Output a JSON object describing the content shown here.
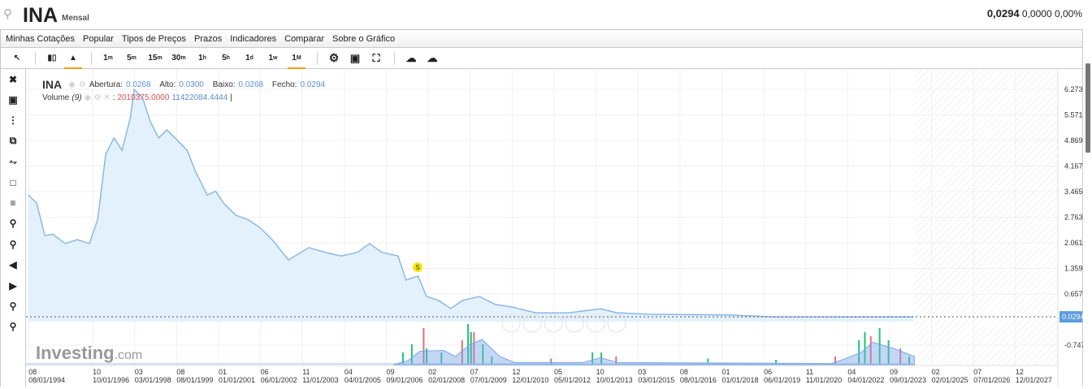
{
  "header": {
    "symbol": "INA",
    "period": "Mensal",
    "price": "0,0294",
    "change": "0,0000",
    "change_pct": "0,00%"
  },
  "menu": [
    "Minhas Cotações",
    "Popular",
    "Tipos de Preços",
    "Prazos",
    "Indicadores",
    "Comparar",
    "Sobre o Gráfico"
  ],
  "toolbar": {
    "intervals": [
      {
        "n": "1",
        "u": "m"
      },
      {
        "n": "5",
        "u": "m"
      },
      {
        "n": "15",
        "u": "m"
      },
      {
        "n": "30",
        "u": "m"
      },
      {
        "n": "1",
        "u": "h"
      },
      {
        "n": "5",
        "u": "h"
      },
      {
        "n": "1",
        "u": "d"
      },
      {
        "n": "1",
        "u": "w"
      },
      {
        "n": "1",
        "u": "M"
      }
    ],
    "active_interval": "1M"
  },
  "legend": {
    "symbol": "INA",
    "open_label": "Abertura:",
    "open": "0.0268",
    "high_label": "Alto:",
    "high": "0.0300",
    "low_label": "Baixo:",
    "low": "0.0268",
    "close_label": "Fecho:",
    "close": "0.0294",
    "volume_label": "Volume",
    "volume_period": "(9)",
    "volume_value": "2010375.0000",
    "volume_ma": "11422084.4444",
    "cursor": "|"
  },
  "watermark": "Investing",
  "watermark_suffix": ".com",
  "marker": "S",
  "colors": {
    "line": "#8ab8e6",
    "fill": "#e3f1fc",
    "up": "#1ec47a",
    "down": "#e0707a",
    "vol_ma": "#7aa6e8",
    "accent": "#f39c12"
  },
  "chart_data": {
    "type": "area",
    "y_ticks": [
      "6.2730",
      "5.5710",
      "4.8690",
      "4.1670",
      "3.4650",
      "2.7630",
      "2.0610",
      "1.3590",
      "0.6570",
      "-0.7470"
    ],
    "ylim": [
      -0.747,
      6.273
    ],
    "last_price": "0.0294",
    "x_ticks": [
      [
        "08",
        "08/01/1994"
      ],
      [
        "10",
        "10/01/1996"
      ],
      [
        "03",
        "03/01/1998"
      ],
      [
        "08",
        "08/01/1999"
      ],
      [
        "01",
        "01/01/2001"
      ],
      [
        "06",
        "06/01/2002"
      ],
      [
        "11",
        "11/01/2003"
      ],
      [
        "04",
        "04/01/2005"
      ],
      [
        "09",
        "09/01/2006"
      ],
      [
        "02",
        "02/01/2008"
      ],
      [
        "07",
        "07/01/2009"
      ],
      [
        "12",
        "12/01/2010"
      ],
      [
        "05",
        "05/01/2012"
      ],
      [
        "10",
        "10/01/2013"
      ],
      [
        "03",
        "03/01/2015"
      ],
      [
        "08",
        "08/01/2016"
      ],
      [
        "01",
        "01/01/2018"
      ],
      [
        "06",
        "06/01/2019"
      ],
      [
        "11",
        "11/01/2020"
      ],
      [
        "04",
        "04/01/2022"
      ],
      [
        "09",
        "09/01/2023"
      ],
      [
        "02",
        "02/01/2025"
      ],
      [
        "07",
        "07/01/2026"
      ],
      [
        "12",
        "12/01/2027"
      ]
    ],
    "xlim": [
      1994.58,
      2027.92
    ],
    "price": [
      [
        1994.58,
        3.37
      ],
      [
        1994.86,
        3.15
      ],
      [
        1995.13,
        2.26
      ],
      [
        1995.4,
        2.3
      ],
      [
        1995.82,
        2.04
      ],
      [
        1996.23,
        2.15
      ],
      [
        1996.64,
        2.04
      ],
      [
        1996.92,
        2.71
      ],
      [
        1997.19,
        4.49
      ],
      [
        1997.47,
        4.94
      ],
      [
        1997.74,
        4.6
      ],
      [
        1998.02,
        5.49
      ],
      [
        1998.15,
        6.27
      ],
      [
        1998.43,
        6.05
      ],
      [
        1998.7,
        5.38
      ],
      [
        1998.98,
        4.94
      ],
      [
        1999.25,
        5.16
      ],
      [
        1999.53,
        4.94
      ],
      [
        1999.94,
        4.6
      ],
      [
        2000.21,
        4.04
      ],
      [
        2000.62,
        3.37
      ],
      [
        2000.9,
        3.48
      ],
      [
        2001.17,
        3.15
      ],
      [
        2001.58,
        2.82
      ],
      [
        2001.99,
        2.7
      ],
      [
        2002.4,
        2.48
      ],
      [
        2002.81,
        2.15
      ],
      [
        2003.36,
        1.59
      ],
      [
        2004.05,
        1.93
      ],
      [
        2004.6,
        1.8
      ],
      [
        2005.15,
        1.7
      ],
      [
        2005.69,
        1.8
      ],
      [
        2006.1,
        2.04
      ],
      [
        2006.51,
        1.8
      ],
      [
        2007.06,
        1.7
      ],
      [
        2007.33,
        1.04
      ],
      [
        2007.74,
        1.15
      ],
      [
        2008.02,
        0.59
      ],
      [
        2008.43,
        0.48
      ],
      [
        2008.84,
        0.26
      ],
      [
        2009.25,
        0.48
      ],
      [
        2009.8,
        0.59
      ],
      [
        2010.35,
        0.37
      ],
      [
        2010.9,
        0.3
      ],
      [
        2011.72,
        0.14
      ],
      [
        2012.81,
        0.14
      ],
      [
        2013.91,
        0.25
      ],
      [
        2014.46,
        0.14
      ],
      [
        2015.56,
        0.1
      ],
      [
        2018.3,
        0.08
      ],
      [
        2019.67,
        0.03
      ],
      [
        2021.04,
        0.03
      ],
      [
        2024.47,
        0.03
      ]
    ],
    "volume": [
      [
        2007.2,
        0.3
      ],
      [
        2007.5,
        0.5
      ],
      [
        2007.9,
        0.9
      ],
      [
        2008.0,
        0.4
      ],
      [
        2008.5,
        0.3
      ],
      [
        2009.2,
        0.6
      ],
      [
        2009.4,
        1.0
      ],
      [
        2009.5,
        0.8
      ],
      [
        2009.6,
        0.8
      ],
      [
        2009.9,
        0.5
      ],
      [
        2010.2,
        0.2
      ],
      [
        2012.2,
        0.15
      ],
      [
        2013.6,
        0.3
      ],
      [
        2013.9,
        0.3
      ],
      [
        2014.4,
        0.2
      ],
      [
        2017.5,
        0.15
      ],
      [
        2019.8,
        0.12
      ],
      [
        2021.8,
        0.2
      ],
      [
        2022.6,
        0.6
      ],
      [
        2022.8,
        0.8
      ],
      [
        2023.0,
        0.7
      ],
      [
        2023.3,
        0.9
      ],
      [
        2023.6,
        0.6
      ],
      [
        2024.0,
        0.4
      ],
      [
        2024.3,
        0.2
      ]
    ],
    "volume_ma": [
      [
        2006.9,
        0
      ],
      [
        2007.4,
        0.1
      ],
      [
        2007.8,
        0.33
      ],
      [
        2008.6,
        0.35
      ],
      [
        2009.0,
        0.2
      ],
      [
        2009.5,
        0.5
      ],
      [
        2009.9,
        0.62
      ],
      [
        2010.5,
        0.2
      ],
      [
        2011.0,
        0.05
      ],
      [
        2013.3,
        0.05
      ],
      [
        2013.9,
        0.17
      ],
      [
        2014.5,
        0.05
      ],
      [
        2021.7,
        0.03
      ],
      [
        2022.0,
        0.1
      ],
      [
        2022.7,
        0.3
      ],
      [
        2023.1,
        0.55
      ],
      [
        2023.8,
        0.4
      ],
      [
        2024.5,
        0.2
      ]
    ]
  }
}
